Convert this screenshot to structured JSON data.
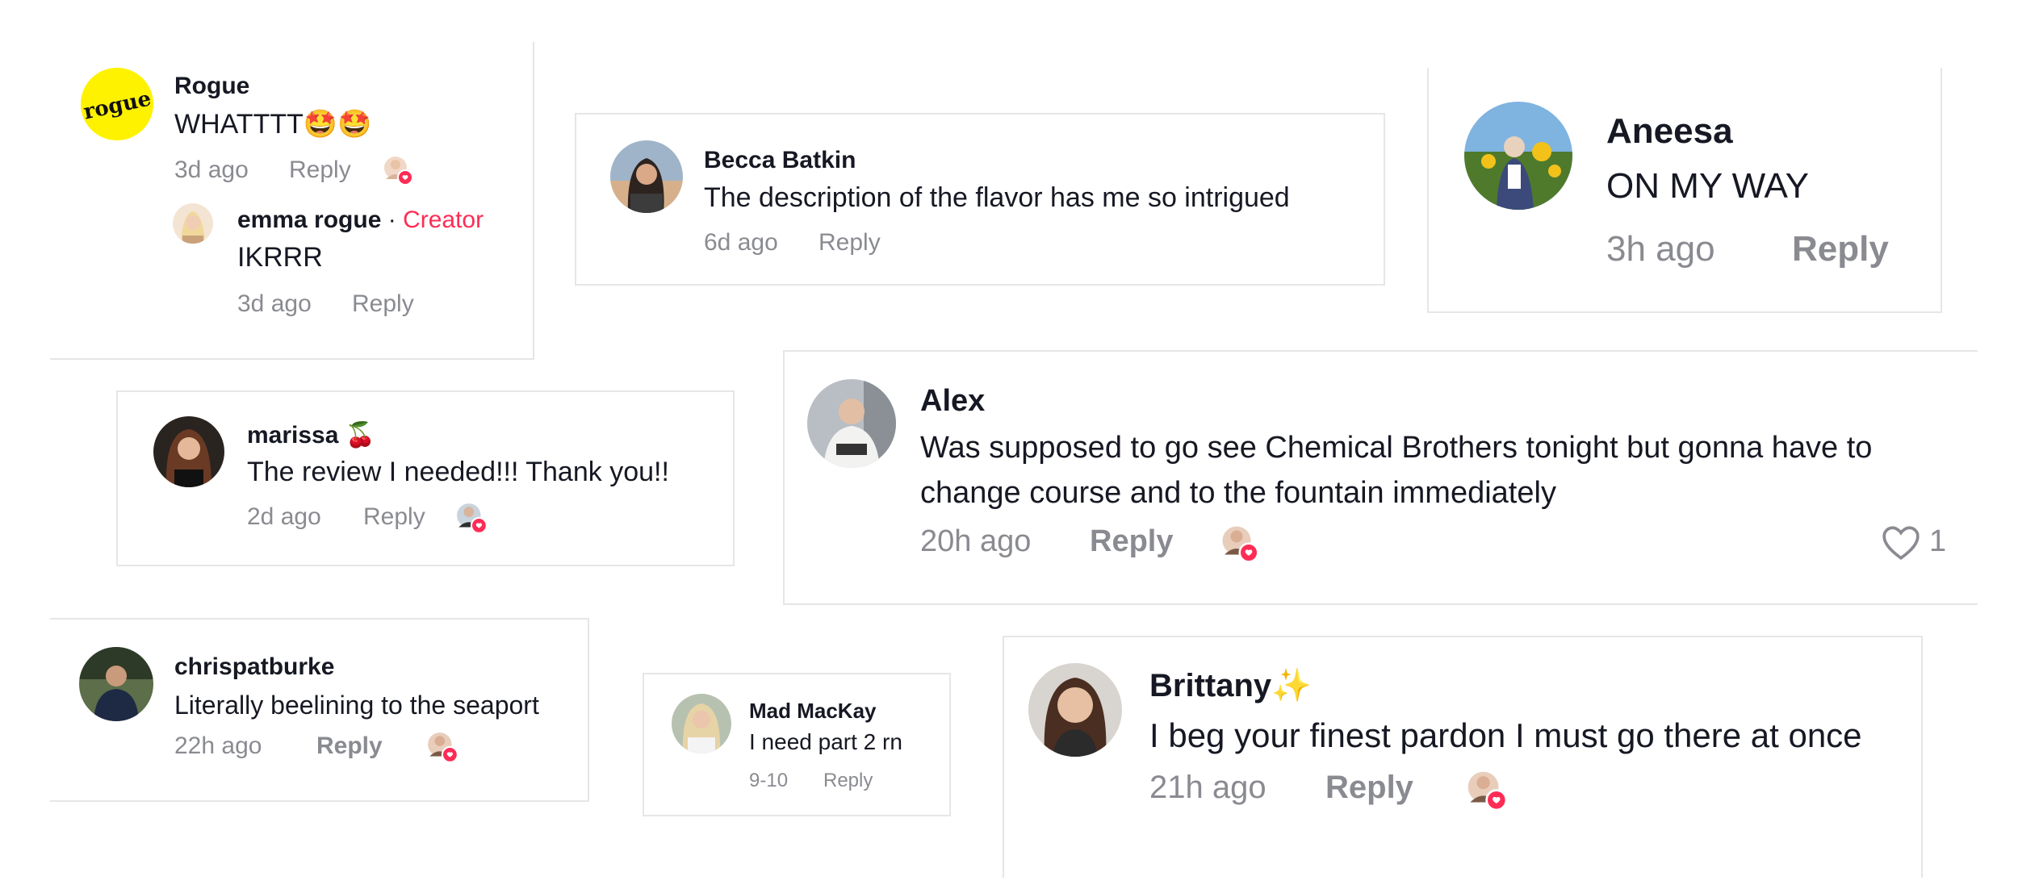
{
  "colors": {
    "accent": "#fe2c55",
    "text": "#161823",
    "muted": "#8a8b91",
    "border": "#e6e6e6",
    "rogue_logo_bg": "#fff200"
  },
  "comments": [
    {
      "author": "Rogue",
      "avatar": "rogue-logo-avatar",
      "logo_text": "rogue",
      "text": "WHATTTT🤩🤩",
      "time": "3d ago",
      "reply_label": "Reply",
      "liked_by_creator": true,
      "reply": {
        "author": "emma rogue",
        "separator": " · ",
        "badge": "Creator",
        "text": "IKRRR",
        "time": "3d ago",
        "reply_label": "Reply"
      }
    },
    {
      "author": "Becca Batkin",
      "text": "The description of the flavor has me so intrigued",
      "time": "6d ago",
      "reply_label": "Reply",
      "liked_by_creator": false
    },
    {
      "author": "Aneesa",
      "text": "ON MY WAY",
      "time": "3h ago",
      "reply_label": "Reply",
      "liked_by_creator": false
    },
    {
      "author": "marissa 🍒",
      "text": "The review I needed!!! Thank you!!",
      "time": "2d ago",
      "reply_label": "Reply",
      "liked_by_creator": true
    },
    {
      "author": "Alex",
      "text_line1": "Was supposed to go see Chemical Brothers tonight but gonna have to",
      "text_line2": "change course and to the fountain immediately",
      "time": "20h ago",
      "reply_label": "Reply",
      "liked_by_creator": true,
      "likes": "1",
      "like_icon": "heart-outline-icon"
    },
    {
      "author": "chrispatburke",
      "text": "Literally beelining to the seaport",
      "time": "22h ago",
      "reply_label": "Reply",
      "liked_by_creator": true
    },
    {
      "author": "Mad MacKay",
      "text": "I need part 2 rn",
      "time": "9-10",
      "reply_label": "Reply",
      "liked_by_creator": false
    },
    {
      "author": "Brittany✨",
      "text": "I beg your finest pardon I must go there at once",
      "time": "21h ago",
      "reply_label": "Reply",
      "liked_by_creator": true
    }
  ]
}
